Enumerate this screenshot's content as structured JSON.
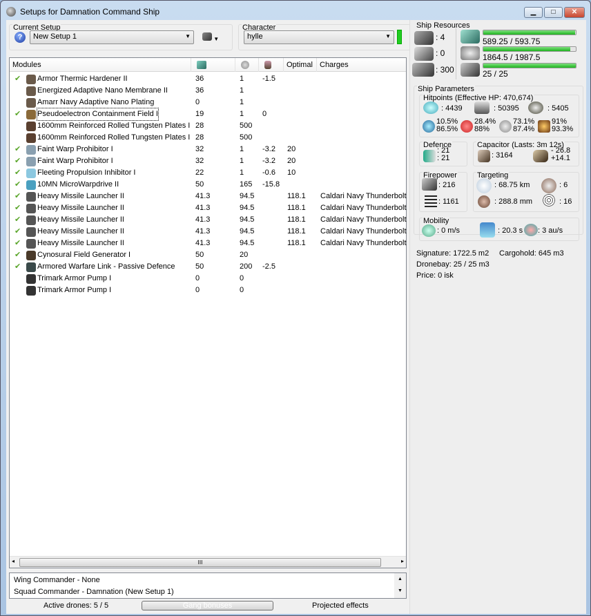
{
  "window": {
    "title": "Setups for Damnation Command Ship",
    "minimize": "▁",
    "maximize": "□",
    "close": "✕"
  },
  "setup": {
    "label": "Current Setup",
    "value": "New Setup 1",
    "help_icon": "?"
  },
  "character": {
    "label": "Character",
    "value": "hylle",
    "status_color": "#22cc22"
  },
  "columns": [
    "Modules",
    "CPU",
    "Powergrid",
    "Capacitor",
    "Optimal",
    "Charges"
  ],
  "modules": [
    {
      "active": true,
      "name": "Armor Thermic Hardener II",
      "cpu": "36",
      "pg": "1",
      "cap": "-1.5",
      "optimal": "",
      "charges": "",
      "color": "#6a5a4a"
    },
    {
      "active": false,
      "name": "Energized Adaptive Nano Membrane II",
      "cpu": "36",
      "pg": "1",
      "cap": "",
      "optimal": "",
      "charges": "",
      "color": "#6a5a4a"
    },
    {
      "active": false,
      "name": "Amarr Navy Adaptive Nano Plating",
      "cpu": "0",
      "pg": "1",
      "cap": "",
      "optimal": "",
      "charges": "",
      "color": "#6a5a4a"
    },
    {
      "active": true,
      "name": "Pseudoelectron Containment Field I",
      "cpu": "19",
      "pg": "1",
      "cap": "0",
      "optimal": "",
      "charges": "",
      "color": "#8a6a3a",
      "focused": true
    },
    {
      "active": false,
      "name": "1600mm Reinforced Rolled Tungsten Plates I",
      "cpu": "28",
      "pg": "500",
      "cap": "",
      "optimal": "",
      "charges": "",
      "color": "#5a4030"
    },
    {
      "active": false,
      "name": "1600mm Reinforced Rolled Tungsten Plates I",
      "cpu": "28",
      "pg": "500",
      "cap": "",
      "optimal": "",
      "charges": "",
      "color": "#5a4030"
    },
    {
      "active": true,
      "name": "Faint Warp Prohibitor I",
      "cpu": "32",
      "pg": "1",
      "cap": "-3.2",
      "optimal": "20",
      "charges": "",
      "color": "#8aa0b0"
    },
    {
      "active": true,
      "name": "Faint Warp Prohibitor I",
      "cpu": "32",
      "pg": "1",
      "cap": "-3.2",
      "optimal": "20",
      "charges": "",
      "color": "#8aa0b0"
    },
    {
      "active": true,
      "name": "Fleeting Propulsion Inhibitor I",
      "cpu": "22",
      "pg": "1",
      "cap": "-0.6",
      "optimal": "10",
      "charges": "",
      "color": "#8cc8e0"
    },
    {
      "active": true,
      "name": "10MN MicroWarpdrive II",
      "cpu": "50",
      "pg": "165",
      "cap": "-15.8",
      "optimal": "",
      "charges": "",
      "color": "#4aa0c0"
    },
    {
      "active": true,
      "name": "Heavy Missile Launcher II",
      "cpu": "41.3",
      "pg": "94.5",
      "cap": "",
      "optimal": "118.1",
      "charges": "Caldari Navy Thunderbolt",
      "color": "#555"
    },
    {
      "active": true,
      "name": "Heavy Missile Launcher II",
      "cpu": "41.3",
      "pg": "94.5",
      "cap": "",
      "optimal": "118.1",
      "charges": "Caldari Navy Thunderbolt",
      "color": "#555"
    },
    {
      "active": true,
      "name": "Heavy Missile Launcher II",
      "cpu": "41.3",
      "pg": "94.5",
      "cap": "",
      "optimal": "118.1",
      "charges": "Caldari Navy Thunderbolt",
      "color": "#555"
    },
    {
      "active": true,
      "name": "Heavy Missile Launcher II",
      "cpu": "41.3",
      "pg": "94.5",
      "cap": "",
      "optimal": "118.1",
      "charges": "Caldari Navy Thunderbolt",
      "color": "#555"
    },
    {
      "active": true,
      "name": "Heavy Missile Launcher II",
      "cpu": "41.3",
      "pg": "94.5",
      "cap": "",
      "optimal": "118.1",
      "charges": "Caldari Navy Thunderbolt",
      "color": "#555"
    },
    {
      "active": true,
      "name": "Cynosural Field Generator I",
      "cpu": "50",
      "pg": "20",
      "cap": "",
      "optimal": "",
      "charges": "",
      "color": "#4a3a2a"
    },
    {
      "active": true,
      "name": "Armored Warfare Link - Passive Defence",
      "cpu": "50",
      "pg": "200",
      "cap": "-2.5",
      "optimal": "",
      "charges": "",
      "color": "#3a4a4a"
    },
    {
      "active": false,
      "name": "Trimark Armor Pump I",
      "cpu": "0",
      "pg": "0",
      "cap": "",
      "optimal": "",
      "charges": "",
      "color": "#333"
    },
    {
      "active": false,
      "name": "Trimark Armor Pump I",
      "cpu": "0",
      "pg": "0",
      "cap": "",
      "optimal": "",
      "charges": "",
      "color": "#333"
    }
  ],
  "check_glyph": "✔",
  "scroll_grip": "III",
  "commanders": [
    "Wing Commander - None",
    "Squad Commander - Damnation (New Setup 1)"
  ],
  "footer": {
    "drones": "Active drones: 5 / 5",
    "gang": "Gang bonuses",
    "projected": "Projected effects"
  },
  "resources": {
    "label": "Ship Resources",
    "turrets": ": 4",
    "launchers": ": 0",
    "calibration": ": 300",
    "cpu": {
      "text": "589.25 / 593.75",
      "fraction": 0.992
    },
    "pg": {
      "text": "1864.5 / 1987.5",
      "fraction": 0.938
    },
    "drone_bw": {
      "text": "25 / 25",
      "fraction": 1.0
    }
  },
  "params": {
    "label": "Ship Parameters",
    "hp": {
      "label": "Hitpoints (Effective HP: 470,674)",
      "shield": ": 4439",
      "armor": ": 50395",
      "structure": ": 5405",
      "res": [
        [
          "10.5%",
          "86.5%"
        ],
        [
          "28.4%",
          "88%"
        ],
        [
          "73.1%",
          "87.4%"
        ],
        [
          "91%",
          "93.3%"
        ]
      ]
    },
    "defence": {
      "label": "Defence",
      "a": ": 21",
      "b": ": 21"
    },
    "capacitor": {
      "label": "Capacitor (Lasts: 3m 12s)",
      "amount": ": 3164",
      "use": "- 26.8",
      "recharge": "+14.1"
    },
    "firepower": {
      "label": "Firepower",
      "dps": ": 216",
      "volley": ": 1161"
    },
    "targeting": {
      "label": "Targeting",
      "range": ": 68.75 km",
      "targets": ": 6",
      "resolution": ": 288.8 mm",
      "sensor": ": 16"
    },
    "mobility": {
      "label": "Mobility",
      "speed": ": 0 m/s",
      "align": ": 20.3 s",
      "warp": ": 3 au/s"
    },
    "signature": "Signature: 1722.5 m2",
    "cargo": "Cargohold: 645 m3",
    "dronebay": "Dronebay: 25 / 25 m3",
    "price": "Price: 0 isk"
  }
}
